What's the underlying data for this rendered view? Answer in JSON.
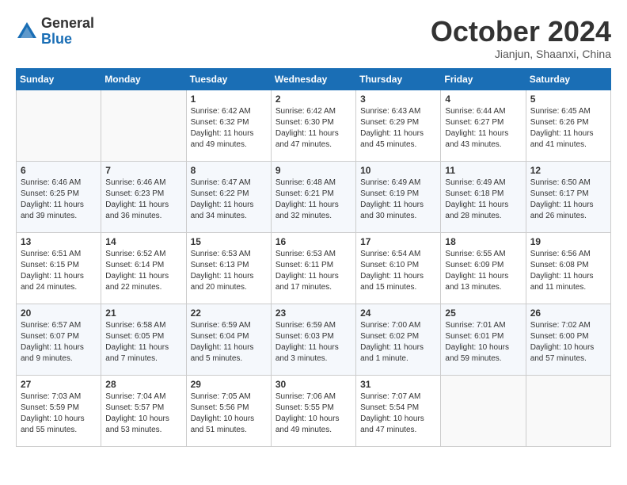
{
  "header": {
    "logo_general": "General",
    "logo_blue": "Blue",
    "month_title": "October 2024",
    "location": "Jianjun, Shaanxi, China"
  },
  "days_of_week": [
    "Sunday",
    "Monday",
    "Tuesday",
    "Wednesday",
    "Thursday",
    "Friday",
    "Saturday"
  ],
  "weeks": [
    [
      {
        "day": "",
        "info": ""
      },
      {
        "day": "",
        "info": ""
      },
      {
        "day": "1",
        "info": "Sunrise: 6:42 AM\nSunset: 6:32 PM\nDaylight: 11 hours and 49 minutes."
      },
      {
        "day": "2",
        "info": "Sunrise: 6:42 AM\nSunset: 6:30 PM\nDaylight: 11 hours and 47 minutes."
      },
      {
        "day": "3",
        "info": "Sunrise: 6:43 AM\nSunset: 6:29 PM\nDaylight: 11 hours and 45 minutes."
      },
      {
        "day": "4",
        "info": "Sunrise: 6:44 AM\nSunset: 6:27 PM\nDaylight: 11 hours and 43 minutes."
      },
      {
        "day": "5",
        "info": "Sunrise: 6:45 AM\nSunset: 6:26 PM\nDaylight: 11 hours and 41 minutes."
      }
    ],
    [
      {
        "day": "6",
        "info": "Sunrise: 6:46 AM\nSunset: 6:25 PM\nDaylight: 11 hours and 39 minutes."
      },
      {
        "day": "7",
        "info": "Sunrise: 6:46 AM\nSunset: 6:23 PM\nDaylight: 11 hours and 36 minutes."
      },
      {
        "day": "8",
        "info": "Sunrise: 6:47 AM\nSunset: 6:22 PM\nDaylight: 11 hours and 34 minutes."
      },
      {
        "day": "9",
        "info": "Sunrise: 6:48 AM\nSunset: 6:21 PM\nDaylight: 11 hours and 32 minutes."
      },
      {
        "day": "10",
        "info": "Sunrise: 6:49 AM\nSunset: 6:19 PM\nDaylight: 11 hours and 30 minutes."
      },
      {
        "day": "11",
        "info": "Sunrise: 6:49 AM\nSunset: 6:18 PM\nDaylight: 11 hours and 28 minutes."
      },
      {
        "day": "12",
        "info": "Sunrise: 6:50 AM\nSunset: 6:17 PM\nDaylight: 11 hours and 26 minutes."
      }
    ],
    [
      {
        "day": "13",
        "info": "Sunrise: 6:51 AM\nSunset: 6:15 PM\nDaylight: 11 hours and 24 minutes."
      },
      {
        "day": "14",
        "info": "Sunrise: 6:52 AM\nSunset: 6:14 PM\nDaylight: 11 hours and 22 minutes."
      },
      {
        "day": "15",
        "info": "Sunrise: 6:53 AM\nSunset: 6:13 PM\nDaylight: 11 hours and 20 minutes."
      },
      {
        "day": "16",
        "info": "Sunrise: 6:53 AM\nSunset: 6:11 PM\nDaylight: 11 hours and 17 minutes."
      },
      {
        "day": "17",
        "info": "Sunrise: 6:54 AM\nSunset: 6:10 PM\nDaylight: 11 hours and 15 minutes."
      },
      {
        "day": "18",
        "info": "Sunrise: 6:55 AM\nSunset: 6:09 PM\nDaylight: 11 hours and 13 minutes."
      },
      {
        "day": "19",
        "info": "Sunrise: 6:56 AM\nSunset: 6:08 PM\nDaylight: 11 hours and 11 minutes."
      }
    ],
    [
      {
        "day": "20",
        "info": "Sunrise: 6:57 AM\nSunset: 6:07 PM\nDaylight: 11 hours and 9 minutes."
      },
      {
        "day": "21",
        "info": "Sunrise: 6:58 AM\nSunset: 6:05 PM\nDaylight: 11 hours and 7 minutes."
      },
      {
        "day": "22",
        "info": "Sunrise: 6:59 AM\nSunset: 6:04 PM\nDaylight: 11 hours and 5 minutes."
      },
      {
        "day": "23",
        "info": "Sunrise: 6:59 AM\nSunset: 6:03 PM\nDaylight: 11 hours and 3 minutes."
      },
      {
        "day": "24",
        "info": "Sunrise: 7:00 AM\nSunset: 6:02 PM\nDaylight: 11 hours and 1 minute."
      },
      {
        "day": "25",
        "info": "Sunrise: 7:01 AM\nSunset: 6:01 PM\nDaylight: 10 hours and 59 minutes."
      },
      {
        "day": "26",
        "info": "Sunrise: 7:02 AM\nSunset: 6:00 PM\nDaylight: 10 hours and 57 minutes."
      }
    ],
    [
      {
        "day": "27",
        "info": "Sunrise: 7:03 AM\nSunset: 5:59 PM\nDaylight: 10 hours and 55 minutes."
      },
      {
        "day": "28",
        "info": "Sunrise: 7:04 AM\nSunset: 5:57 PM\nDaylight: 10 hours and 53 minutes."
      },
      {
        "day": "29",
        "info": "Sunrise: 7:05 AM\nSunset: 5:56 PM\nDaylight: 10 hours and 51 minutes."
      },
      {
        "day": "30",
        "info": "Sunrise: 7:06 AM\nSunset: 5:55 PM\nDaylight: 10 hours and 49 minutes."
      },
      {
        "day": "31",
        "info": "Sunrise: 7:07 AM\nSunset: 5:54 PM\nDaylight: 10 hours and 47 minutes."
      },
      {
        "day": "",
        "info": ""
      },
      {
        "day": "",
        "info": ""
      }
    ]
  ]
}
